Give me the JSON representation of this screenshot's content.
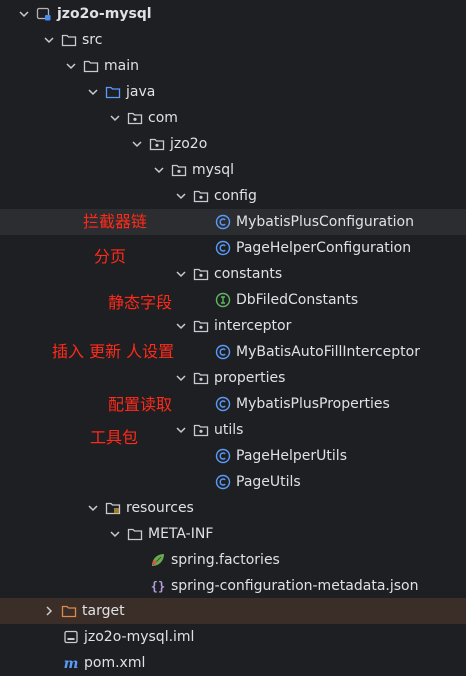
{
  "tree": {
    "project": "jzo2o-mysql",
    "src": "src",
    "main": "main",
    "java": "java",
    "com": "com",
    "jzo2o": "jzo2o",
    "mysql": "mysql",
    "config": "config",
    "config_class_1": "MybatisPlusConfiguration",
    "config_class_2": "PageHelperConfiguration",
    "constants": "constants",
    "constants_iface": "DbFiledConstants",
    "interceptor": "interceptor",
    "interceptor_class": "MyBatisAutoFillInterceptor",
    "properties": "properties",
    "properties_class": "MybatisPlusProperties",
    "utils": "utils",
    "utils_class_1": "PageHelperUtils",
    "utils_class_2": "PageUtils",
    "resources": "resources",
    "meta_inf": "META-INF",
    "spring_factories": "spring.factories",
    "metadata_json": "spring-configuration-metadata.json",
    "target": "target",
    "iml": "jzo2o-mysql.iml",
    "pom": "pom.xml"
  },
  "annotations": {
    "interceptor_chain": "拦截器链",
    "paging": "分页",
    "static_fields": "静态字段",
    "insert_update": "插入 更新 人设置",
    "config_read": "配置读取",
    "toolkit": "工具包"
  },
  "colors": {
    "background": "#1e1f22",
    "selected_row": "#2b2d30",
    "target_row": "#3b2e28",
    "annotation_red": "#ff2a1a",
    "class_icon": "#5b9bf8",
    "interface_icon": "#5fb85f"
  }
}
